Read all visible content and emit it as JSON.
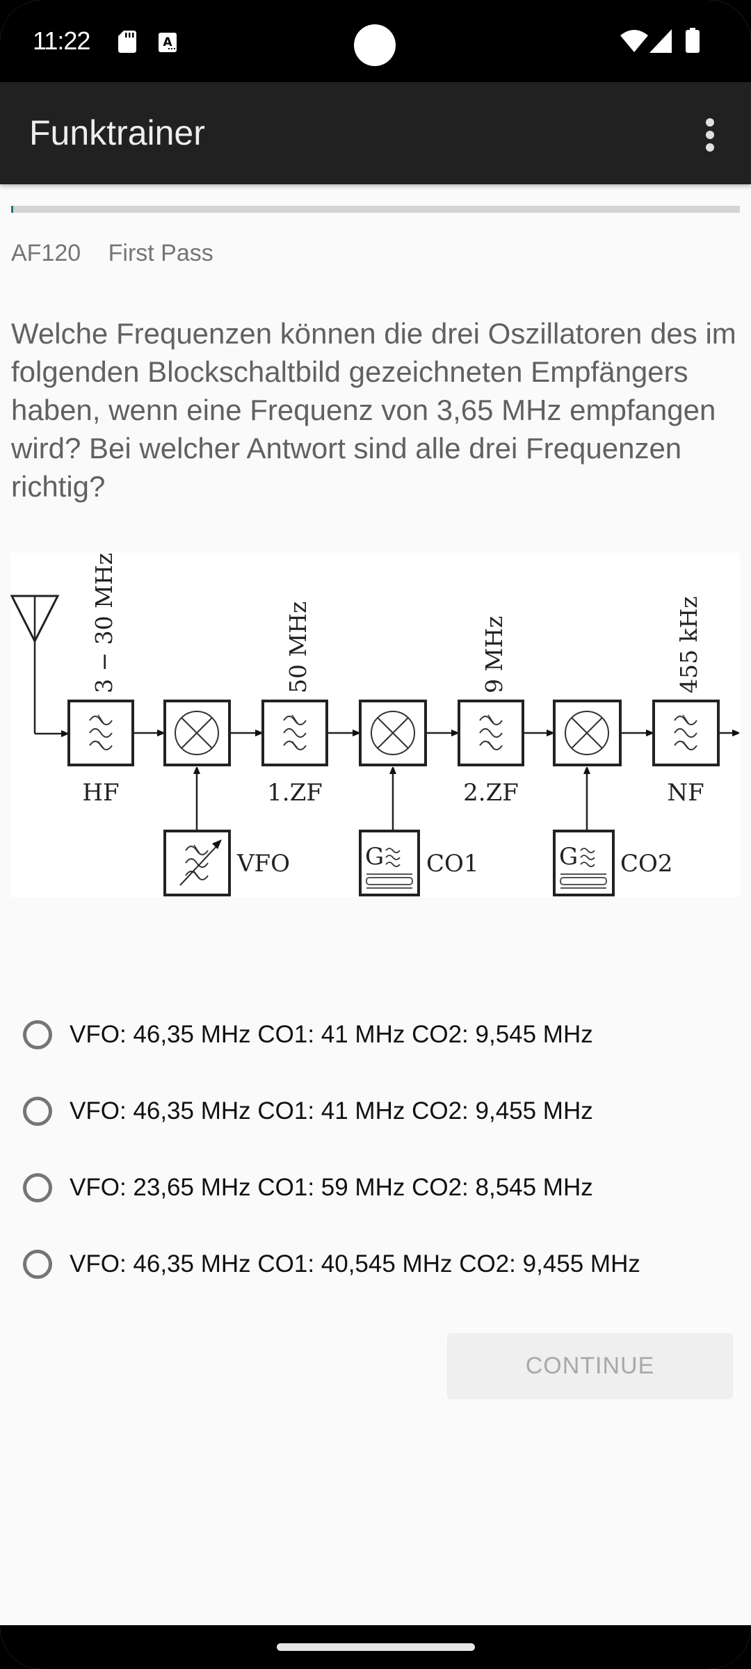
{
  "status_bar": {
    "time": "11:22",
    "left_icons": [
      "sd-card-icon",
      "text-notification-icon"
    ],
    "right_icons": [
      "wifi-icon",
      "cell-signal-icon",
      "battery-icon"
    ]
  },
  "toolbar": {
    "title": "Funktrainer",
    "menu_icon": "more-vert-icon"
  },
  "progress": {
    "value_fraction": 0.003,
    "color": "#1b7a72"
  },
  "question": {
    "id": "AF120",
    "mode": "First Pass",
    "text": "Welche Frequenzen können die drei Oszillatoren des im folgenden Blockschaltbild gezeichneten Empfängers haben, wenn eine Frequenz von 3,65 MHz empfangen wird? Bei welcher Antwort sind alle drei Frequenzen richtig?"
  },
  "diagram": {
    "stages": [
      {
        "label": "HF",
        "freq": "3 − 30 MHz"
      },
      {
        "label": "1.ZF",
        "freq": "50 MHz"
      },
      {
        "label": "2.ZF",
        "freq": "9 MHz"
      },
      {
        "label": "NF",
        "freq": "455 kHz"
      }
    ],
    "oscillators": [
      {
        "label": "VFO"
      },
      {
        "label": "CO1",
        "glyph": "G"
      },
      {
        "label": "CO2",
        "glyph": "G"
      }
    ]
  },
  "answers": [
    {
      "label": "VFO: 46,35 MHz CO1: 41 MHz CO2: 9,545 MHz",
      "selected": false
    },
    {
      "label": "VFO: 46,35 MHz CO1: 41 MHz CO2: 9,455 MHz",
      "selected": false
    },
    {
      "label": "VFO: 23,65 MHz CO1: 59 MHz CO2: 8,545 MHz",
      "selected": false
    },
    {
      "label": "VFO: 46,35 MHz CO1: 40,545 MHz CO2: 9,455 MHz",
      "selected": false
    }
  ],
  "actions": {
    "continue_label": "CONTINUE",
    "continue_enabled": false
  }
}
